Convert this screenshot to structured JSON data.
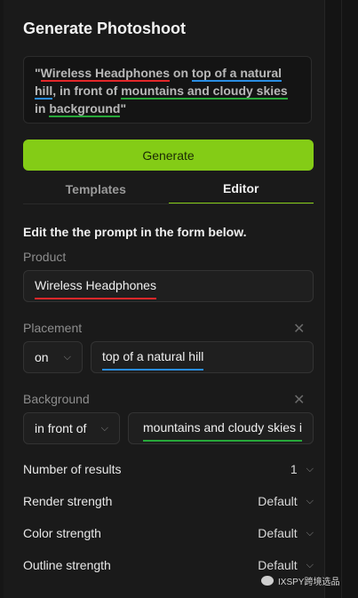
{
  "panel": {
    "title": "Generate Photoshoot",
    "prompt": {
      "open_quote": "\"",
      "product": "Wireless Headphones",
      "on_word": "on",
      "placement": "top of a natural hill",
      "comma": ",",
      "in_front_of": "in front of",
      "background_part1": "mountains and cloudy skies",
      "in_word": "in",
      "background_part2": "background",
      "close_quote": "\""
    },
    "generate_label": "Generate",
    "tabs": [
      {
        "label": "Templates",
        "active": false
      },
      {
        "label": "Editor",
        "active": true
      }
    ],
    "instruction": "Edit the the prompt in the form below.",
    "product": {
      "label": "Product",
      "value": "Wireless Headphones"
    },
    "placement": {
      "label": "Placement",
      "preposition": "on",
      "value": "top of a natural hill"
    },
    "background": {
      "label": "Background",
      "preposition": "in front of",
      "value": "mountains and cloudy skies i"
    },
    "settings": [
      {
        "label": "Number of results",
        "value": "1"
      },
      {
        "label": "Render strength",
        "value": "Default"
      },
      {
        "label": "Color strength",
        "value": "Default"
      },
      {
        "label": "Outline strength",
        "value": "Default"
      }
    ]
  },
  "watermark": "IXSPY跨境选品",
  "colors": {
    "accent": "#84cc16",
    "underline_red": "#e3272a",
    "underline_blue": "#2a8de3",
    "underline_green": "#27a83a"
  },
  "icons": {
    "chevron": "chevron-down-icon",
    "close": "close-icon"
  }
}
